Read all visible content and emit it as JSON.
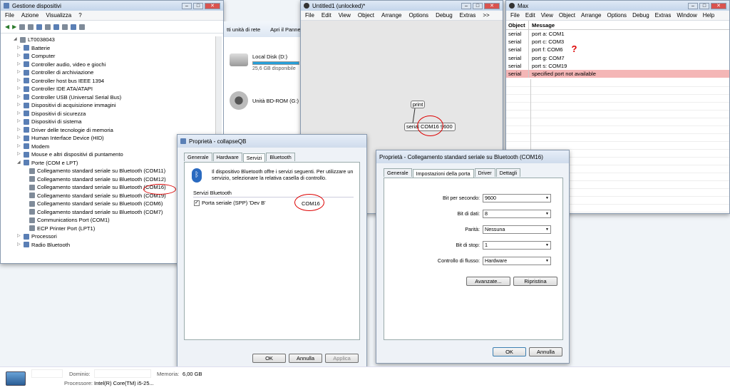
{
  "devmgr": {
    "title": "Gestione dispositivi",
    "menu": [
      "File",
      "Azione",
      "Visualizza",
      "?"
    ],
    "root": "LT0038043",
    "items": [
      "Batterie",
      "Computer",
      "Controller audio, video e giochi",
      "Controller di archiviazione",
      "Controller host bus IEEE 1394",
      "Controller IDE ATA/ATAPI",
      "Controller USB (Universal Serial Bus)",
      "Dispositivi di acquisizione immagini",
      "Dispositivi di sicurezza",
      "Dispositivi di sistema",
      "Driver delle tecnologie di memoria",
      "Human Interface Device (HID)",
      "Modem",
      "Mouse e altri dispositivi di puntamento",
      "Porte (COM e LPT)"
    ],
    "ports": [
      "Collegamento standard seriale su Bluetooth (COM11)",
      "Collegamento standard seriale su Bluetooth (COM12)",
      "Collegamento standard seriale su Bluetooth (COM16)",
      "Collegamento standard seriale su Bluetooth (COM19)",
      "Collegamento standard seriale su Bluetooth (COM6)",
      "Collegamento standard seriale su Bluetooth (COM7)",
      "Communications Port (COM1)",
      "ECP Printer Port (LPT1)"
    ],
    "after": [
      "Processori",
      "Radio Bluetooth"
    ]
  },
  "explorer": {
    "toolbar_a": "tti unità di rete",
    "toolbar_b": "Apri il Panne",
    "disk1": "Local Disk (D:)",
    "disk1_size": "25,6 GB disponibile",
    "disk2": "Unità BD-ROM (G:)"
  },
  "patcher": {
    "title": "Untitled1 (unlocked)*",
    "menu": [
      "File",
      "Edit",
      "View",
      "Object",
      "Arrange",
      "Options",
      "Debug",
      "Extras",
      ">>"
    ],
    "print_obj": "print",
    "serial_obj": "serial COM16 9600"
  },
  "maxwin": {
    "title": "Max",
    "menu": [
      "File",
      "Edit",
      "View",
      "Object",
      "Arrange",
      "Options",
      "Debug",
      "Extras",
      "Window",
      "Help"
    ],
    "col1": "Object",
    "col2": "Message",
    "rows": [
      {
        "o": "serial",
        "m": "port a: COM1"
      },
      {
        "o": "serial",
        "m": "port c: COM3"
      },
      {
        "o": "serial",
        "m": "port f: COM6"
      },
      {
        "o": "serial",
        "m": "port g: COM7"
      },
      {
        "o": "serial",
        "m": "port s: COM19"
      },
      {
        "o": "serial",
        "m": "specified port not available"
      }
    ],
    "qmark": "?",
    "error_color": "#f4b6b6"
  },
  "props1": {
    "title": "Proprietà - collapseQB",
    "tabs": [
      "Generale",
      "Hardware",
      "Servizi",
      "Bluetooth"
    ],
    "desc": "Il dispositivo Bluetooth offre i servizi seguenti. Per utilizzare un servizio, selezionare la relativa casella di controllo.",
    "group": "Servizi Bluetooth",
    "service": "Porta seriale (SPP) 'Dev B'",
    "com": "COM16",
    "ok": "OK",
    "cancel": "Annulla",
    "apply": "Applica"
  },
  "props2": {
    "title": "Proprietà - Collegamento standard seriale su Bluetooth (COM16)",
    "tabs": [
      "Generale",
      "Impostazioni della porta",
      "Driver",
      "Dettagli"
    ],
    "fields": [
      {
        "l": "Bit per secondo:",
        "v": "9600"
      },
      {
        "l": "Bit di dati:",
        "v": "8"
      },
      {
        "l": "Parità:",
        "v": "Nessuna"
      },
      {
        "l": "Bit di stop:",
        "v": "1"
      },
      {
        "l": "Controllo di flusso:",
        "v": "Hardware"
      }
    ],
    "advanced": "Avanzate...",
    "restore": "Ripristina",
    "ok": "OK",
    "cancel": "Annulla"
  },
  "status": {
    "dom_l": "Dominio:",
    "mem_l": "Memoria:",
    "mem_v": "6,00 GB",
    "cpu_l": "Processore:",
    "cpu_v": "Intel(R) Core(TM) i5-25..."
  }
}
